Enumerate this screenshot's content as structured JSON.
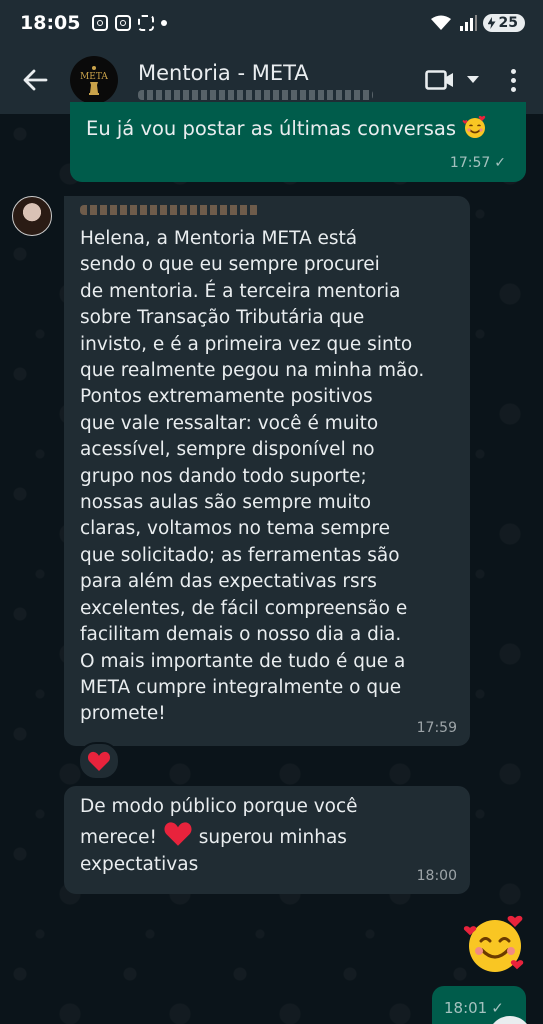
{
  "status_bar": {
    "time": "18:05",
    "battery": "25"
  },
  "header": {
    "title": "Mentoria - META",
    "logo_text": "META"
  },
  "messages": [
    {
      "direction": "out",
      "text": "Eu já vou postar as últimas  conversas",
      "time": "17:57"
    },
    {
      "direction": "in",
      "text": "Helena, a Mentoria META está\nsendo o que eu sempre procurei\nde mentoria. É a terceira mentoria\nsobre Transação Tributária que\ninvisto, e é a primeira vez que sinto\nque realmente pegou na minha mão.\nPontos extremamente positivos\nque vale ressaltar: você é muito\nacessível, sempre disponível no\ngrupo nos dando todo suporte;\nnossas aulas são sempre muito\nclaras, voltamos no tema sempre\nque solicitado; as ferramentas são\npara além das expectativas rsrs\nexcelentes, de fácil compreensão e\nfacilitam demais o nosso dia a dia.\nO mais importante de tudo é que a\nMETA cumpre integralmente o que\npromete!",
      "time": "17:59",
      "reaction": "red-heart"
    },
    {
      "direction": "in",
      "text_before": "De modo público porque você\nmerece! ",
      "text_after": " superou minhas\nexpectativas",
      "time": "18:00"
    },
    {
      "direction": "out",
      "emoji": "smiling-face-with-hearts",
      "time": "18:01"
    }
  ],
  "colors": {
    "app_bar": "#1f2c34",
    "background": "#0b141a",
    "outgoing_bubble": "#005c4b",
    "incoming_bubble": "#202c33",
    "heart": "#e8233c"
  }
}
